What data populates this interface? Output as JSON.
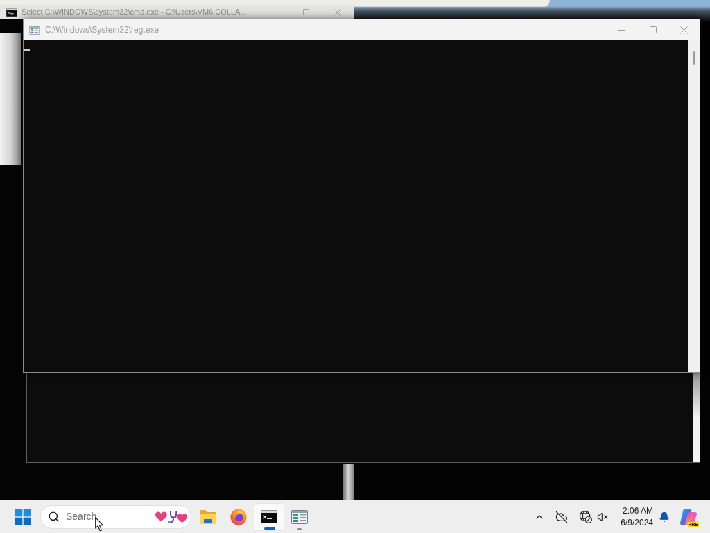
{
  "back_window": {
    "title": "Select C:\\WINDOWS\\system32\\cmd.exe - C:\\Users\\VM6.COLLA..."
  },
  "front_window": {
    "title": "C:\\Windows\\System32\\reg.exe"
  },
  "taskbar": {
    "search": {
      "placeholder": "Search"
    },
    "apps": [
      {
        "kind": "file-explorer",
        "selected": false,
        "running": false
      },
      {
        "kind": "firefox",
        "selected": false,
        "running": false
      },
      {
        "kind": "terminal",
        "selected": true,
        "running": true
      },
      {
        "kind": "registry",
        "selected": false,
        "running": true
      }
    ],
    "clock": {
      "time": "2:06 AM",
      "date": "6/9/2024"
    },
    "copilot": {
      "badge": "PRE"
    }
  }
}
